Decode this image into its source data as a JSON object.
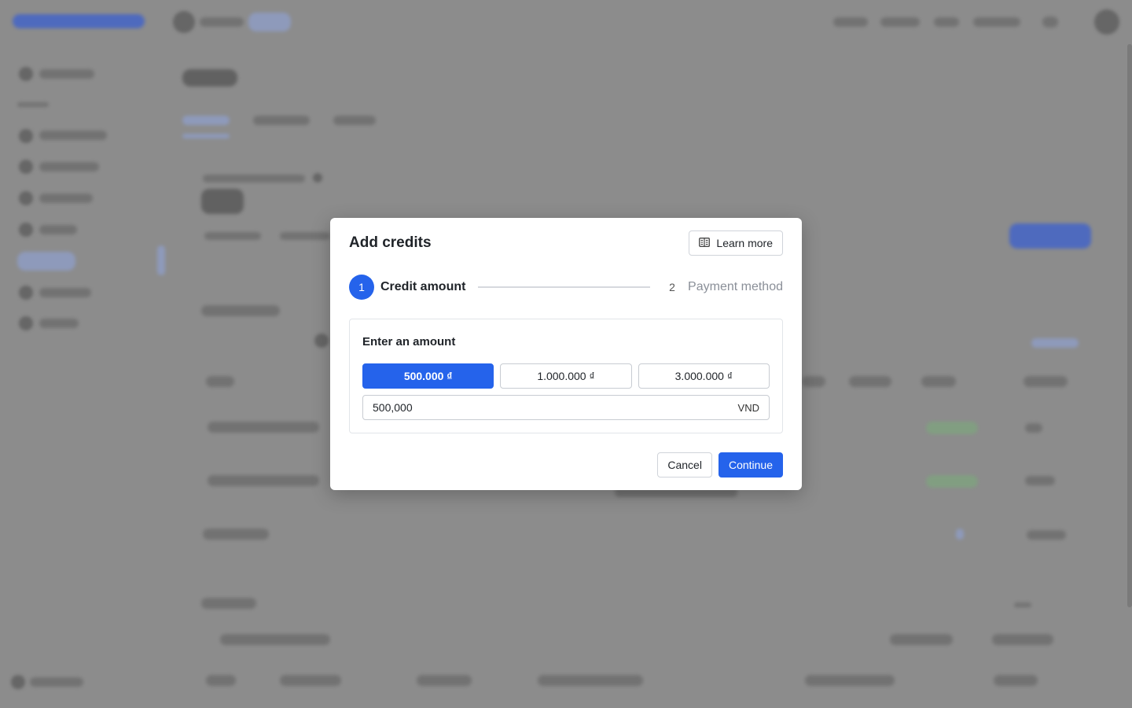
{
  "dialog": {
    "title": "Add credits",
    "learn_more_label": "Learn more",
    "steps": [
      {
        "number": "1",
        "label": "Credit amount",
        "active": true
      },
      {
        "number": "2",
        "label": "Payment method",
        "active": false
      }
    ],
    "amount_section": {
      "title": "Enter an amount",
      "presets": [
        "500.000 ₫",
        "1.000.000 ₫",
        "3.000.000 ₫"
      ],
      "selected_preset_index": 0,
      "input_value": "500,000",
      "currency": "VND"
    },
    "cancel_label": "Cancel",
    "continue_label": "Continue"
  },
  "colors": {
    "accent": "#2563eb",
    "overlay": "#8c8c8c"
  },
  "icons": {
    "learn_more": "book-icon"
  }
}
